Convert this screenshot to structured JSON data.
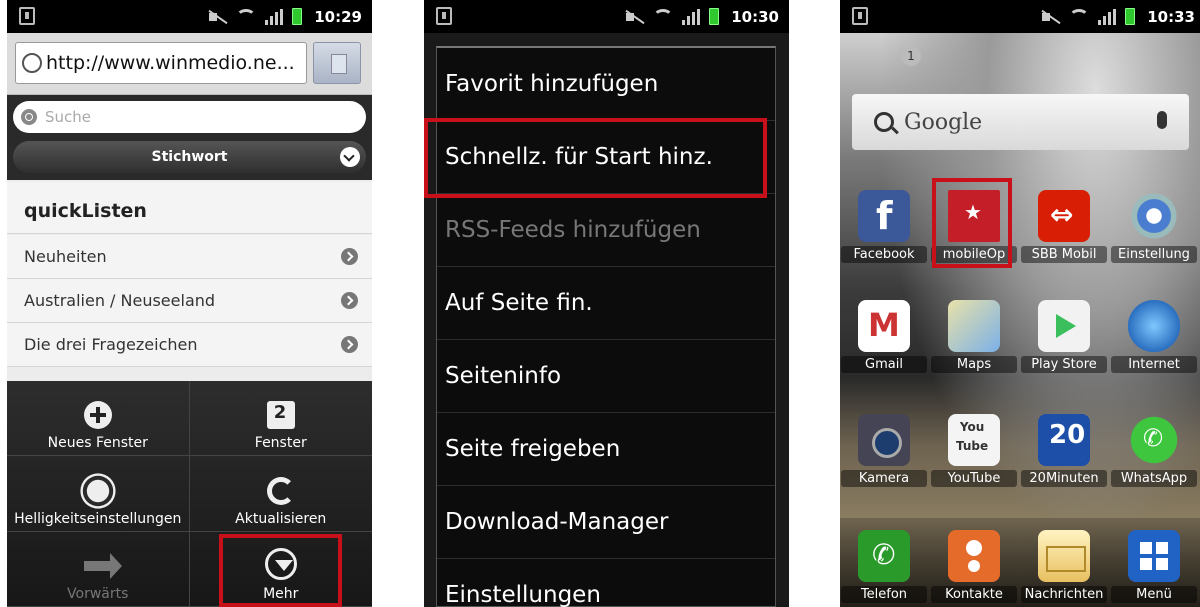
{
  "phone1": {
    "status": {
      "time": "10:29"
    },
    "url": "http://www.winmedio.ne...",
    "search_placeholder": "Suche",
    "dropdown_value": "Stichwort",
    "section_title": "quickListen",
    "list_items": [
      "Neuheiten",
      "Australien / Neuseeland",
      "Die drei Fragezeichen"
    ],
    "menu": [
      {
        "label": "Neues Fenster",
        "icon": "plus-icon"
      },
      {
        "label": "Fenster",
        "icon": "windows-icon"
      },
      {
        "label": "Helligkeitseinstellungen",
        "icon": "brightness-icon"
      },
      {
        "label": "Aktualisieren",
        "icon": "refresh-icon"
      },
      {
        "label": "Vorwärts",
        "icon": "forward-arrow-icon",
        "disabled": true
      },
      {
        "label": "Mehr",
        "icon": "more-chevron-icon"
      }
    ]
  },
  "phone2": {
    "status": {
      "time": "10:30"
    },
    "menu_items": [
      {
        "label": "Favorit hinzufügen"
      },
      {
        "label": "Schnellz. für Start hinz."
      },
      {
        "label": "RSS-Feeds hinzufügen",
        "disabled": true
      },
      {
        "label": "Auf Seite fin."
      },
      {
        "label": "Seiteninfo"
      },
      {
        "label": "Seite freigeben"
      },
      {
        "label": "Download-Manager"
      },
      {
        "label": "Einstellungen"
      }
    ]
  },
  "phone3": {
    "status": {
      "time": "10:33"
    },
    "page_indicator": "1",
    "search_widget_label": "Google",
    "apps": [
      {
        "label": "Facebook",
        "icon": "facebook-icon"
      },
      {
        "label": "mobileOp",
        "icon": "mobileopac-bookmark-icon"
      },
      {
        "label": "SBB Mobil",
        "icon": "sbb-icon"
      },
      {
        "label": "Einstellung",
        "icon": "settings-icon"
      },
      {
        "label": "Gmail",
        "icon": "gmail-icon"
      },
      {
        "label": "Maps",
        "icon": "maps-icon"
      },
      {
        "label": "Play Store",
        "icon": "play-store-icon"
      },
      {
        "label": "Internet",
        "icon": "internet-globe-icon"
      },
      {
        "label": "Kamera",
        "icon": "camera-icon"
      },
      {
        "label": "YouTube",
        "icon": "youtube-icon"
      },
      {
        "label": "20Minuten",
        "icon": "20minuten-icon"
      },
      {
        "label": "WhatsApp",
        "icon": "whatsapp-icon"
      }
    ],
    "dock": [
      {
        "label": "Telefon",
        "icon": "phone-icon"
      },
      {
        "label": "Kontakte",
        "icon": "contacts-icon"
      },
      {
        "label": "Nachrichten",
        "icon": "messages-icon"
      },
      {
        "label": "Menü",
        "icon": "app-drawer-icon"
      }
    ]
  },
  "colors": {
    "highlight": "#c8101a",
    "accent_blue": "#3b5998"
  }
}
